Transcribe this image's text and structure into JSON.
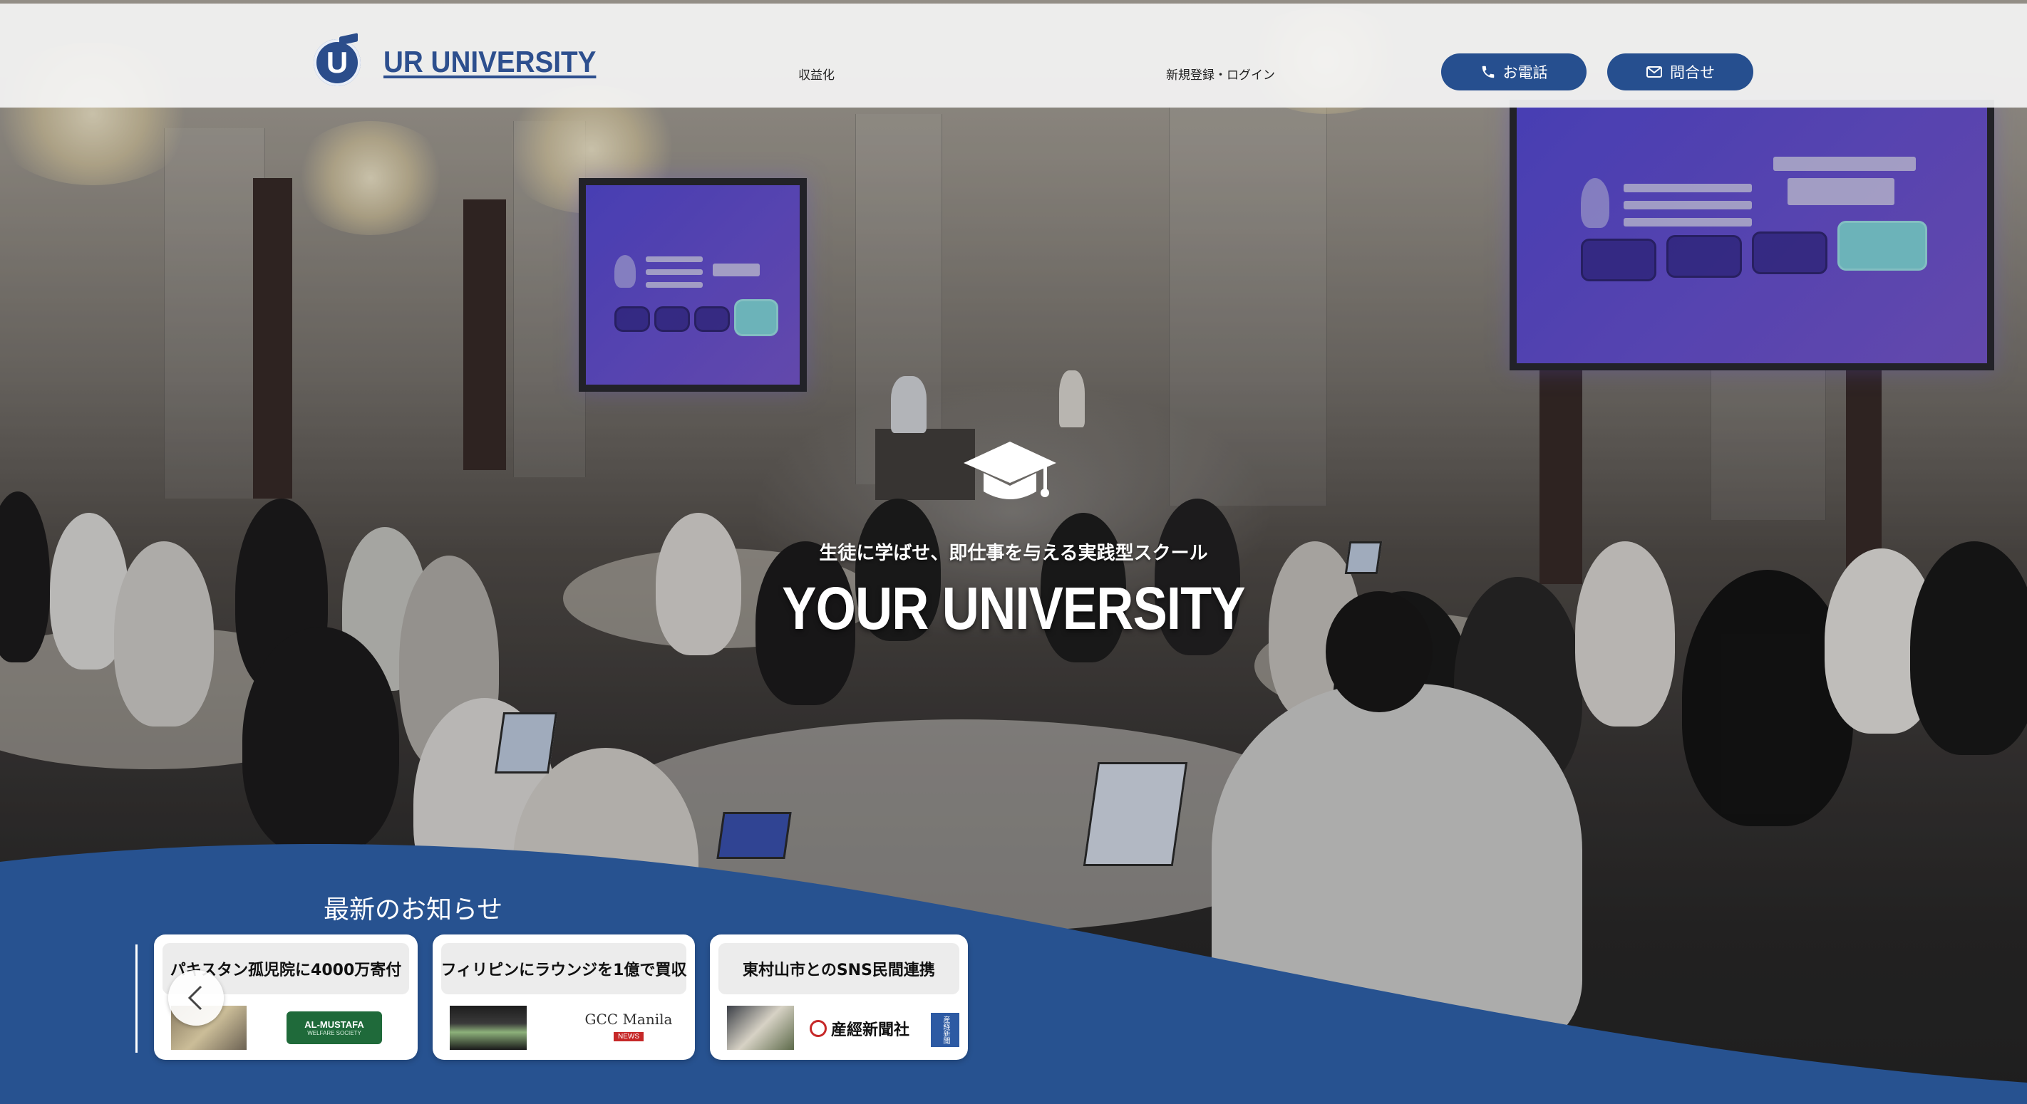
{
  "header": {
    "logo_letter": "U",
    "logo_text": "UR UNIVERSITY",
    "nav": [
      {
        "label": "収益化"
      },
      {
        "label": "新規登録・ログイン"
      }
    ],
    "phone_button": "お電話",
    "contact_button": "問合せ",
    "accent_color": "#264f8f"
  },
  "hero": {
    "icon": "graduation-cap-icon",
    "subtitle": "生徒に学ばせ、即仕事を与える実践型スクール",
    "title": "YOUR UNIVERSITY"
  },
  "news": {
    "heading": "最新のお知らせ",
    "cards": [
      {
        "title": "パキスタン孤児院に4000万寄付",
        "logo_text": "AL-MUSTAFA",
        "logo_sub": "WELFARE SOCIETY"
      },
      {
        "title": "フィリピンにラウンジを1億で買収",
        "logo_text": "GCC Manila",
        "logo_sub": "NEWS"
      },
      {
        "title": "東村山市とのSNS民間連携",
        "logo_text": "産經新聞社",
        "logo_sub": "産経新聞"
      }
    ]
  }
}
